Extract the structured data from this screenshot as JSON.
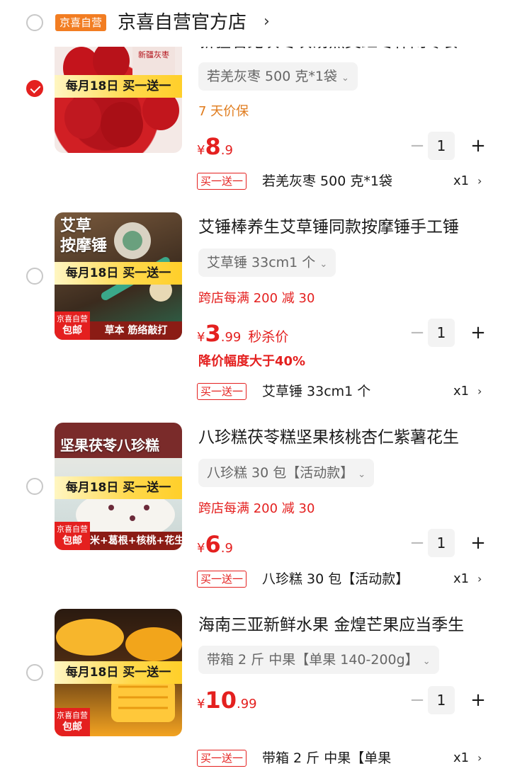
{
  "store": {
    "badge": "京喜自营",
    "name": "京喜自营官方店",
    "chevron": "›"
  },
  "colors": {
    "accent": "#e4201f",
    "badge_orange": "#f27d22"
  },
  "items": [
    {
      "title": "新疆若羌灰枣灰汤煮煲红枣休闲零食",
      "checked": true,
      "thumb_banner": "每月18日 买一送一",
      "thumb_title": "",
      "thumb_strip": "",
      "spec": "若羌灰枣 500 克*1袋",
      "promo": "7 天价保",
      "price_yen": "¥",
      "price_int": "8",
      "price_dec": ".9",
      "price_tag": "",
      "promo2": "",
      "qty": "1",
      "gift_tag": "买一送一",
      "gift_name": "若羌灰枣 500 克*1袋",
      "gift_qty": "x1"
    },
    {
      "title": "艾锤棒养生艾草锤同款按摩锤手工锤",
      "checked": false,
      "thumb_banner": "每月18日 买一送一",
      "thumb_title": "艾草\n按摩锤",
      "thumb_badge_top": "京喜自营",
      "thumb_badge_bottom": "包邮",
      "thumb_strip": "草本  筋络敲打",
      "spec": "艾草锤 33cm1 个",
      "promo": "跨店每满 200 减 30",
      "price_yen": "¥",
      "price_int": "3",
      "price_dec": ".99",
      "price_tag": "秒杀价",
      "promo2": "降价幅度大于40%",
      "qty": "1",
      "gift_tag": "买一送一",
      "gift_name": "艾草锤 33cm1 个",
      "gift_qty": "x1"
    },
    {
      "title": "八珍糕茯苓糕坚果核桃杏仁紫薯花生",
      "checked": false,
      "thumb_banner": "每月18日 买一送一",
      "thumb_title": "坚果茯苓八珍糕",
      "thumb_badge_top": "京喜自营",
      "thumb_badge_bottom": "包邮",
      "thumb_strip": "米+葛根+核桃+花生",
      "spec": "八珍糕 30 包【活动款】",
      "promo": "跨店每满 200 减 30",
      "price_yen": "¥",
      "price_int": "6",
      "price_dec": ".9",
      "price_tag": "",
      "promo2": "",
      "qty": "1",
      "gift_tag": "买一送一",
      "gift_name": "八珍糕 30 包【活动款】",
      "gift_qty": "x1"
    },
    {
      "title": "海南三亚新鲜水果 金煌芒果应当季生",
      "checked": false,
      "thumb_banner": "每月18日 买一送一",
      "thumb_title": "",
      "thumb_badge_top": "京喜自营",
      "thumb_badge_bottom": "包邮",
      "thumb_strip": "",
      "spec": "带箱 2 斤 中果【单果 140-200g】",
      "promo": "",
      "price_yen": "¥",
      "price_int": "10",
      "price_dec": ".99",
      "price_tag": "",
      "promo2": "",
      "qty": "1",
      "gift_tag": "买一送一",
      "gift_name": "带箱 2 斤 中果【单果",
      "gift_qty": "x1"
    }
  ],
  "icons": {
    "minus": "−",
    "plus": "+",
    "chevron_right": "›",
    "chevron_down": "⌄"
  }
}
